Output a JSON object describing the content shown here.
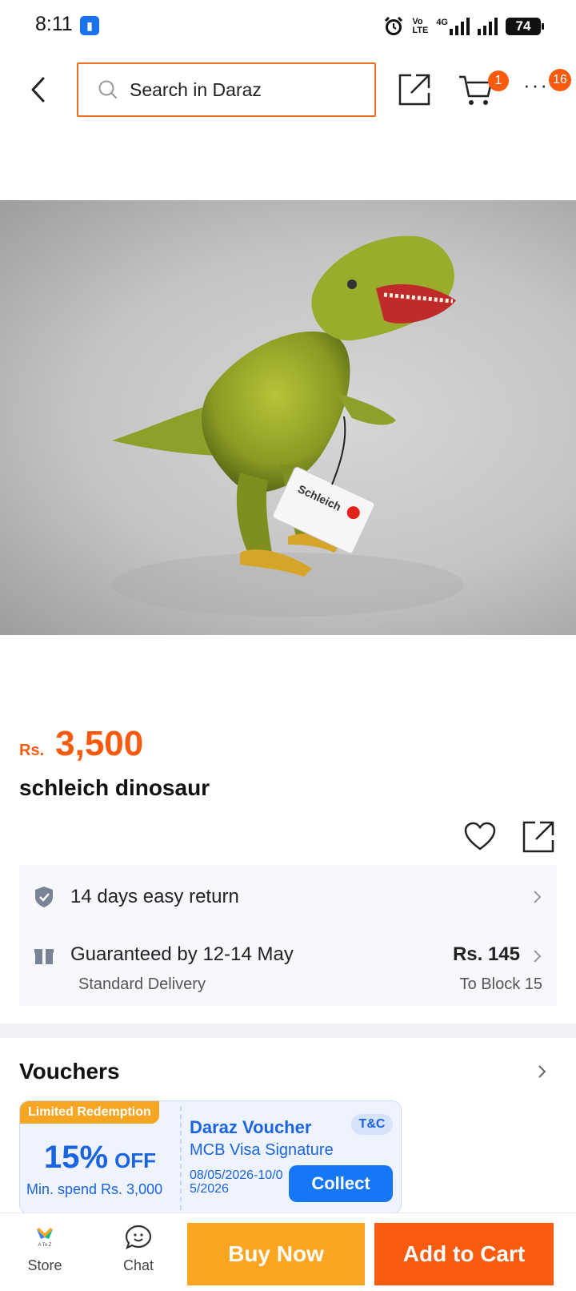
{
  "status_bar": {
    "time": "8:11",
    "network_label_top": "Vo",
    "network_label_bottom": "LTE",
    "network_type": "4G",
    "battery": "74"
  },
  "nav": {
    "search_placeholder": "Search in Daraz",
    "cart_count": "1",
    "more_count": "16"
  },
  "product": {
    "image_tag_text": "Schleich",
    "currency": "Rs.",
    "price": "3,500",
    "title": "schleich dinosaur"
  },
  "services": {
    "return_text": "14 days easy return",
    "delivery_guarantee": "Guaranteed by 12-14 May",
    "delivery_type": "Standard Delivery",
    "delivery_fee": "Rs. 145",
    "delivery_location": "To Block 15"
  },
  "vouchers": {
    "heading": "Vouchers",
    "items": [
      {
        "tag": "Limited Redemption",
        "discount": "15%",
        "discount_suffix": "OFF",
        "min_spend": "Min. spend Rs. 3,000",
        "title": "Daraz Voucher",
        "terms_label": "T&C",
        "subtitle": "MCB Visa Signature",
        "validity": "08/05/2026-10/05/2026",
        "action_label": "Collect"
      }
    ]
  },
  "bottom_bar": {
    "store_label": "Store",
    "store_logo_text": "A To Z",
    "chat_label": "Chat",
    "buy_now_label": "Buy Now",
    "add_to_cart_label": "Add to Cart"
  },
  "colors": {
    "brand_orange": "#f85a10",
    "buy_now_yellow": "#fca520",
    "voucher_blue": "#1a64e0"
  }
}
